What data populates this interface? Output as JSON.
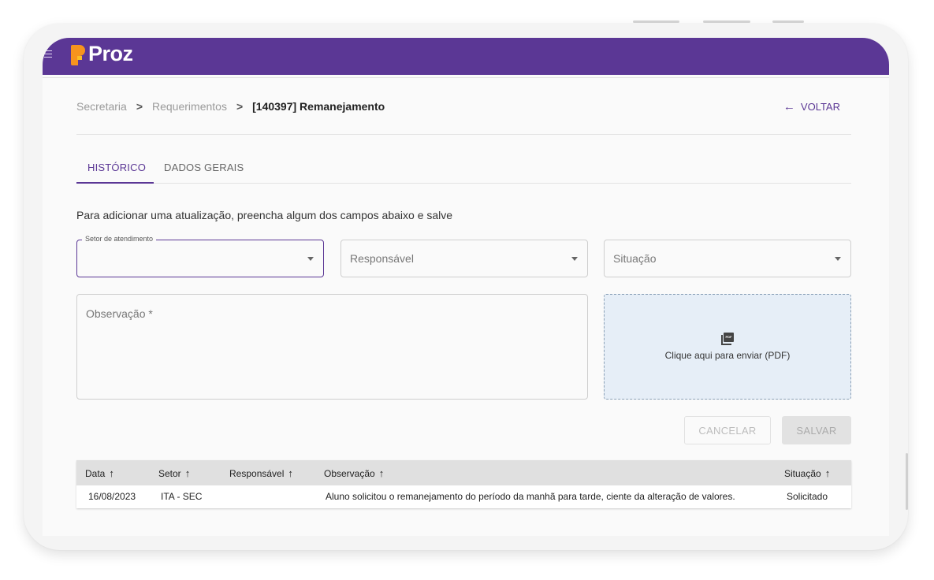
{
  "app": {
    "logo_text": "Proz",
    "brand_color": "#5b3795",
    "logo_color": "#f7941d"
  },
  "breadcrumb": {
    "items": [
      "Secretaria",
      "Requerimentos"
    ],
    "separator": ">",
    "current": "[140397] Remanejamento"
  },
  "back_button": {
    "icon": "arrow-left-icon",
    "label": "VOLTAR"
  },
  "tabs": [
    {
      "label": "HISTÓRICO",
      "active": true
    },
    {
      "label": "DADOS GERAIS",
      "active": false
    }
  ],
  "form": {
    "intro": "Para adicionar uma atualização, preencha algum dos campos abaixo e salve",
    "setor": {
      "label": "Setor de atendimento",
      "value": ""
    },
    "responsavel": {
      "placeholder": "Responsável"
    },
    "situacao": {
      "placeholder": "Situação"
    },
    "observacao": {
      "placeholder": "Observação *"
    },
    "upload": {
      "icon": "pdf-icon",
      "label": "Clique aqui para enviar (PDF)"
    },
    "cancel_label": "CANCELAR",
    "save_label": "SALVAR"
  },
  "table": {
    "sort_icon": "↑",
    "columns": [
      "Data",
      "Setor",
      "Responsável",
      "Observação",
      "Situação"
    ],
    "rows": [
      {
        "data": "16/08/2023",
        "setor": "ITA - SEC",
        "responsavel": "",
        "observacao": "Aluno solicitou o remanejamento do período da manhã para tarde, ciente da alteração de valores.",
        "situacao": "Solicitado"
      }
    ]
  }
}
